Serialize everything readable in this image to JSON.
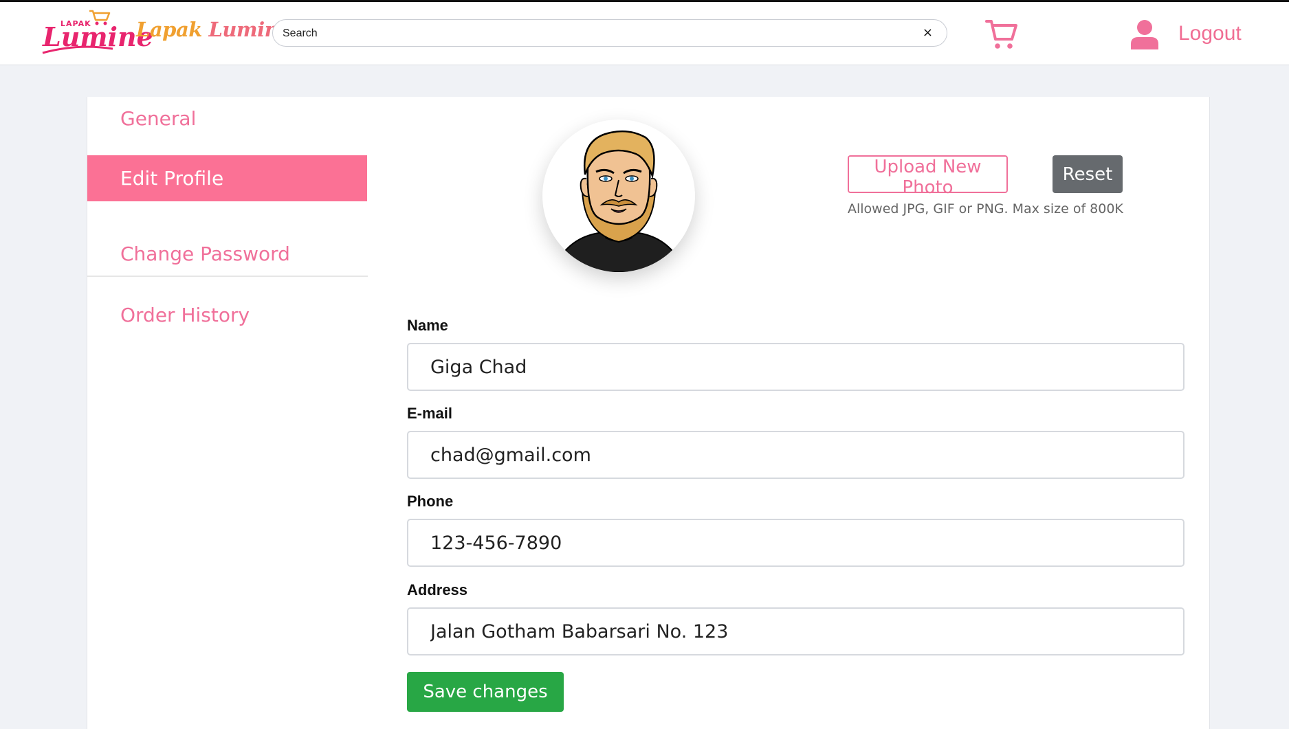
{
  "header": {
    "logo_small": "LAPAK",
    "logo_big": "Lumine",
    "brand_word_1": "Lapak",
    "brand_word_2": "Lumine",
    "search_placeholder": "Search",
    "clear_label": "×",
    "logout_label": "Logout"
  },
  "sidebar": {
    "items": [
      {
        "label": "General"
      },
      {
        "label": "Edit Profile"
      },
      {
        "label": "Change Password"
      },
      {
        "label": "Order History"
      }
    ]
  },
  "photo": {
    "upload_label": "Upload New Photo",
    "reset_label": "Reset",
    "hint": "Allowed JPG, GIF or PNG. Max size of 800K"
  },
  "form": {
    "name_label": "Name",
    "name_value": "Giga Chad",
    "email_label": "E-mail",
    "email_value": "chad@gmail.com",
    "phone_label": "Phone",
    "phone_value": "123-456-7890",
    "address_label": "Address",
    "address_value": "Jalan Gotham Babarsari No. 123",
    "save_label": "Save changes"
  },
  "colors": {
    "brand_pink": "#f0709a",
    "active_pink": "#fb7195",
    "logo_magenta": "#e8256e",
    "brand_orange": "#f0a030",
    "save_green": "#28a745",
    "reset_gray": "#666a6e"
  },
  "icons": {
    "cart": "cart-icon",
    "user": "user-icon",
    "clear": "close-icon"
  }
}
